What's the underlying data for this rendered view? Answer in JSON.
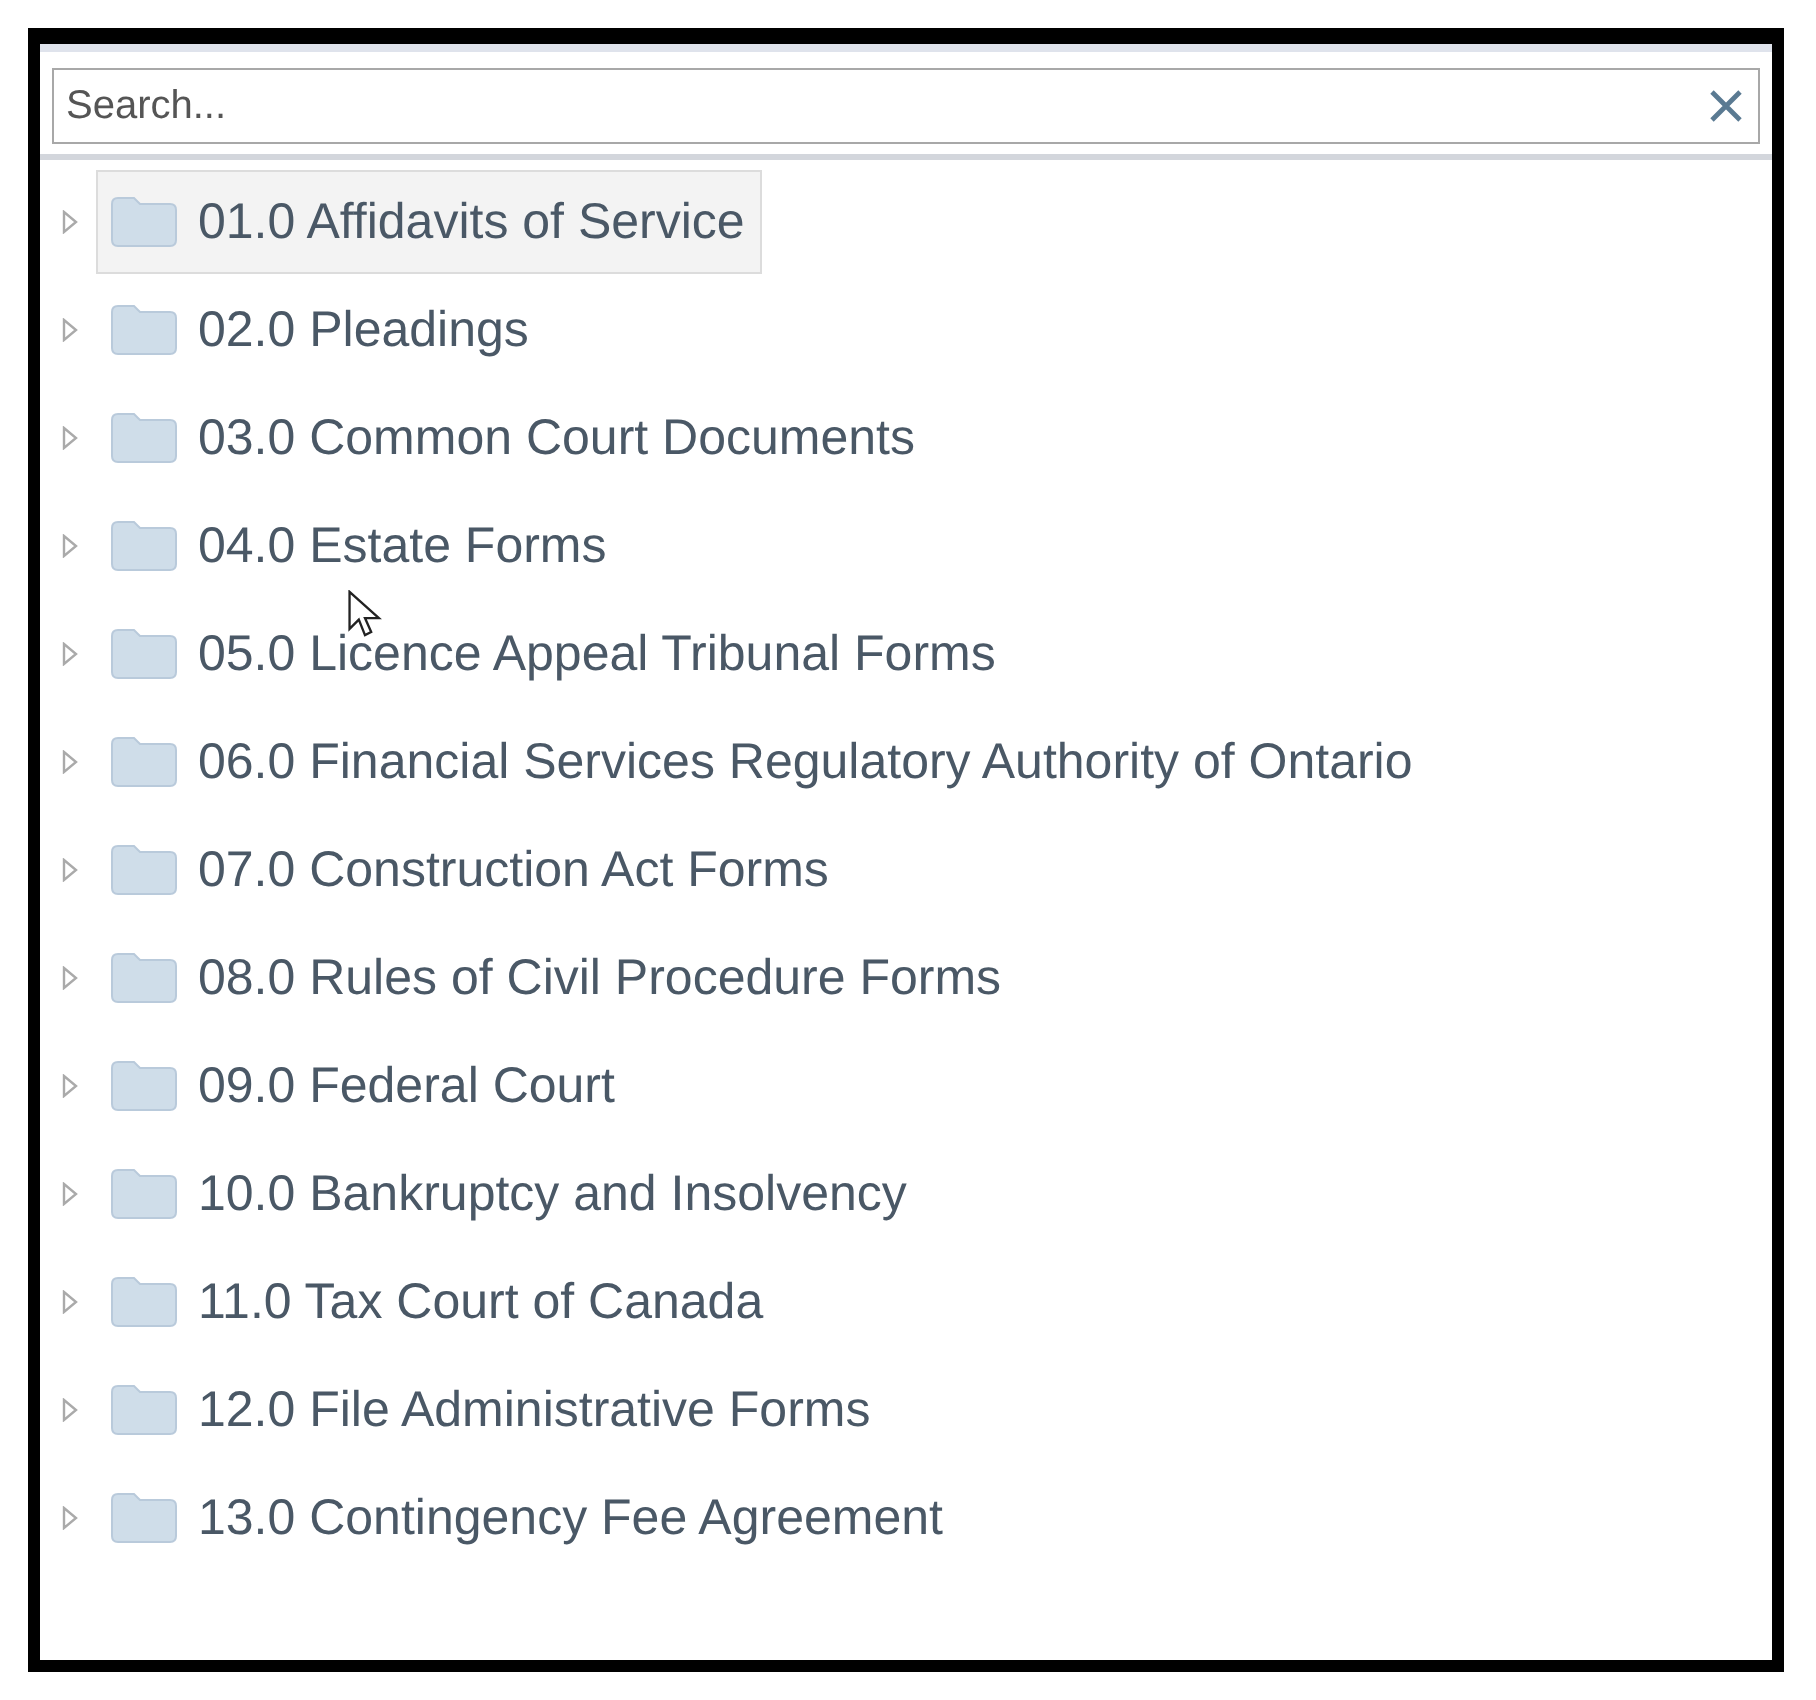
{
  "search": {
    "placeholder": "Search..."
  },
  "tree": [
    {
      "label": "01.0 Affidavits of Service",
      "selected": true,
      "expanded": false
    },
    {
      "label": "02.0 Pleadings",
      "selected": false,
      "expanded": false
    },
    {
      "label": "03.0 Common Court Documents",
      "selected": false,
      "expanded": false
    },
    {
      "label": "04.0 Estate Forms",
      "selected": false,
      "expanded": false
    },
    {
      "label": "05.0 Licence Appeal Tribunal Forms",
      "selected": false,
      "expanded": false
    },
    {
      "label": "06.0 Financial Services Regulatory Authority of Ontario",
      "selected": false,
      "expanded": false
    },
    {
      "label": "07.0 Construction Act Forms",
      "selected": false,
      "expanded": false
    },
    {
      "label": "08.0 Rules of Civil Procedure Forms",
      "selected": false,
      "expanded": false
    },
    {
      "label": "09.0 Federal Court",
      "selected": false,
      "expanded": false
    },
    {
      "label": "10.0 Bankruptcy and Insolvency",
      "selected": false,
      "expanded": false
    },
    {
      "label": "11.0 Tax Court of Canada",
      "selected": false,
      "expanded": false
    },
    {
      "label": "12.0 File Administrative Forms",
      "selected": false,
      "expanded": false
    },
    {
      "label": "13.0 Contingency Fee Agreement",
      "selected": false,
      "expanded": false
    }
  ]
}
